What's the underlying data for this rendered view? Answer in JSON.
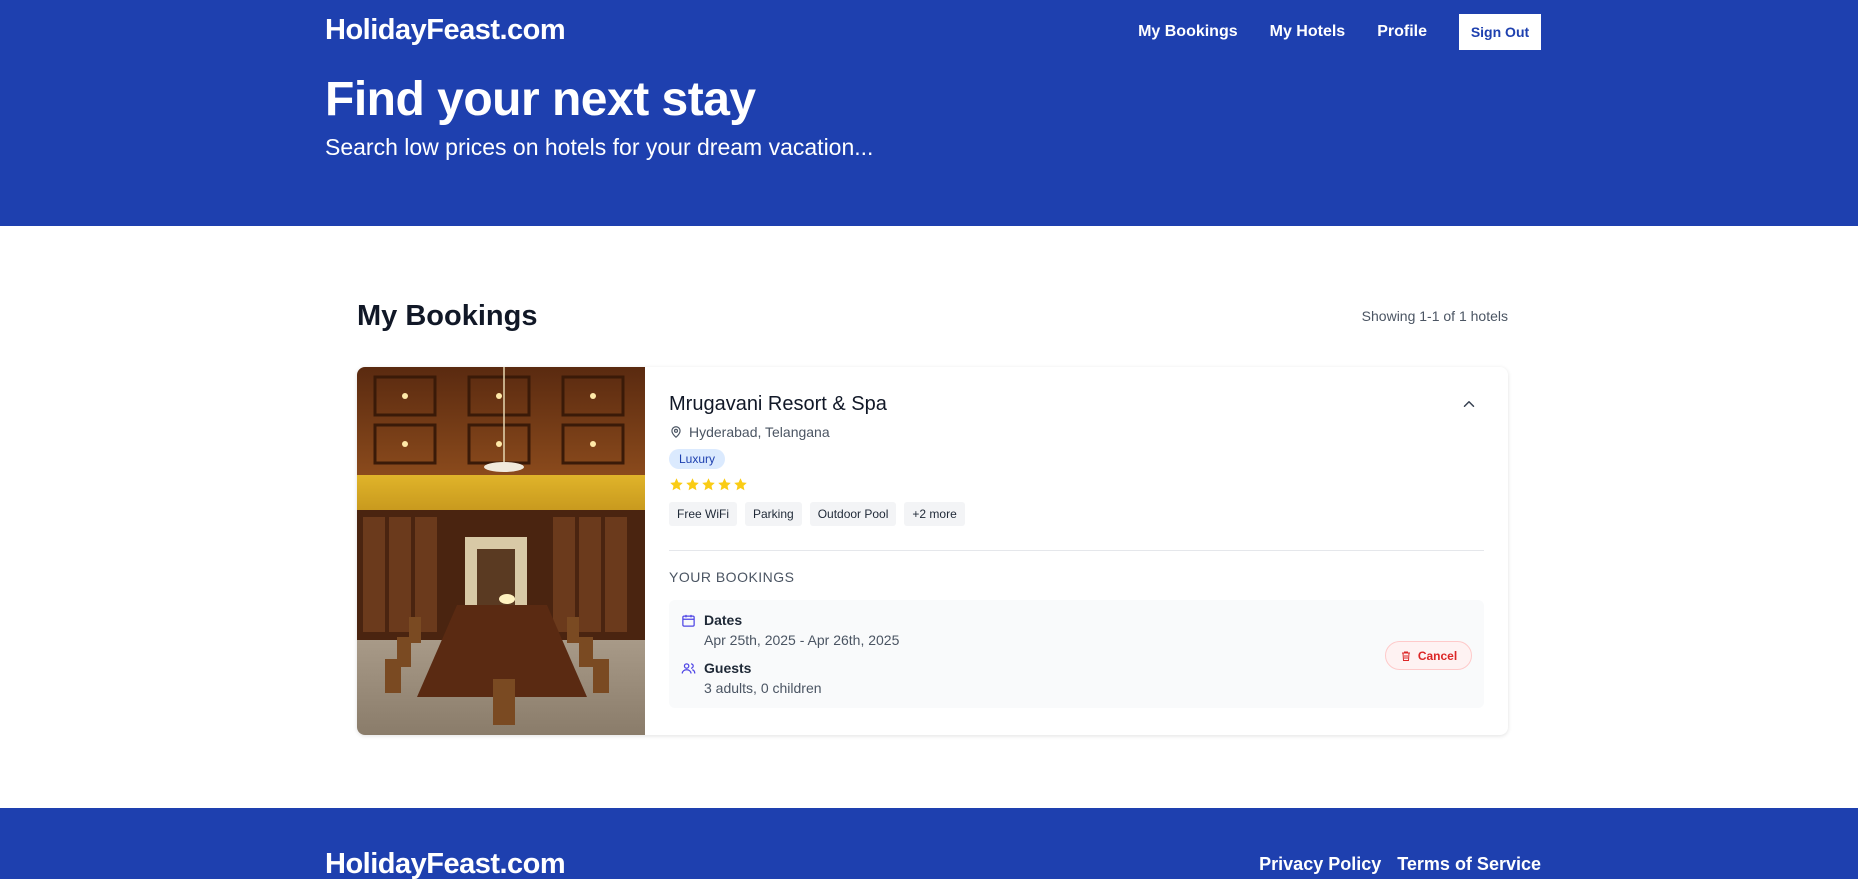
{
  "header": {
    "logo": "HolidayFeast.com",
    "nav": [
      "My Bookings",
      "My Hotels",
      "Profile"
    ],
    "signout_label": "Sign Out",
    "hero_title": "Find your next stay",
    "hero_subtitle": "Search low prices on hotels for your dream vacation..."
  },
  "main": {
    "title": "My Bookings",
    "showing": "Showing 1-1 of 1 hotels"
  },
  "booking_card": {
    "hotel_name": "Mrugavani Resort & Spa",
    "location": "Hyderabad, Telangana",
    "type": "Luxury",
    "star_rating": 5,
    "facilities": [
      "Free WiFi",
      "Parking",
      "Outdoor Pool",
      "+2 more"
    ],
    "bookings_heading": "YOUR BOOKINGS",
    "dates_label": "Dates",
    "dates_value": "Apr 25th, 2025 - Apr 26th, 2025",
    "guests_label": "Guests",
    "guests_value": "3 adults, 0 children",
    "cancel_label": "Cancel"
  },
  "footer": {
    "logo": "HolidayFeast.com",
    "links": [
      "Privacy Policy",
      "Terms of Service"
    ]
  },
  "colors": {
    "brand": "#1e40af",
    "star": "#facc15",
    "danger": "#dc2626"
  },
  "icons": [
    "map-pin-icon",
    "chevron-up-icon",
    "star-icon",
    "calendar-icon",
    "users-icon",
    "trash-icon"
  ]
}
